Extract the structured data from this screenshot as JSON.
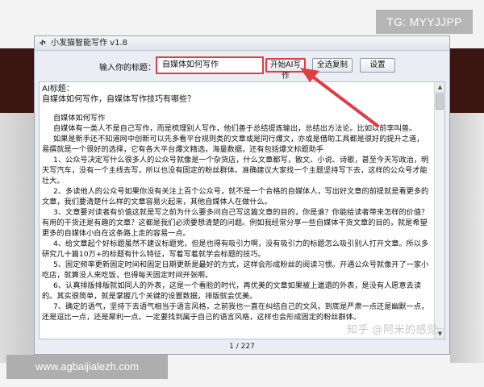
{
  "window": {
    "title": "小发猫智能写作 v1.8"
  },
  "toolbar": {
    "input_label": "输入你的标题：",
    "input_value": "自媒体如何写作",
    "start_button": "开始AI写作",
    "copy_all_button": "全选复制",
    "settings_button": "设置"
  },
  "editor": {
    "ai_label": "AI标题：",
    "ai_question": "自媒体如何写作，自媒体写作技巧有哪些？",
    "article_title": "自媒体如何写作",
    "paragraphs": [
      "自媒体有一类人不是自己写作，而是梳理别人写作，他们善于总结提炼输出，总结出方法论。比如以前李叫兽。",
      "如果是新手还不知道网中创新可以先多看平台规则类的文章或是同行爆文，亦或是借助工具都是很好的提升之道，易撰就是一个很好的选择，它有各大平台爆文精选，海量数据，还有包括爆文标题助手",
      "1、公众号决定写什么很多人的公众号就像是一个杂货店，什么文章都写，散文、小说、诗歌，甚至今天写政治，明天写汽车，没有一个主线去写，所以也没有固定的粉丝群体。准确建议大家找一个主题坚持写下去，这样的公众号才能壮大。",
      "2、多读他人的公众号如果你没有关注上百个公众号，就不是一个合格的自媒体人，写出好文章的前提就是看更多的文章，我们要清楚什么样的文章容易火起来，其他自媒体人在做什么。",
      "3、文章要对读者有价值这就是写之前为什么要多问自己写这篇文章的目的，你是谁？你能给读者带来怎样的价值？有用的干货还是有趣的文章？这都是我们必须要想清楚的问题。例如我经常分享一些自媒体干货文章的目的，就是希望更多的自媒体小白在这条路上走的容易一点。",
      "4、给文章起个好标题虽然不建议标题党，但是也得有吸引力啊，没有吸引力的标题怎么吸引别人打开文章。所以多研究几十篇10万+的标题有什么特征，写着写着就学会标题的技巧。",
      "5、固定频率更新固定时间和固定日期更新是最好的方式，这样会形成粉丝的阅读习惯。开通公众号就像开了一家小吃店，就算没人来吃饭，也得每天固定时间开张啊。",
      "6、认真排版排版就如同人的外表，这是一个看脸的时代，再优美的文章如果被上邋遢的外表，是没有人愿意去读的。其实很简单，就是掌握几个关键的设置数据，排版就会优美。",
      "7、确定的语气，坚持下去语气相当于语言风格，之前我也一直在纠结自己的文风，到底是严肃一点还是幽默一点，还是逗比一点，还是犀利一点。一定要找到属于自己的语言风格，这样也会形成固定的粉丝群体。"
    ]
  },
  "pager": {
    "label": "1 / 227"
  },
  "overlays": {
    "top_right_tag": "TG: MYYJJPP",
    "bottom_left_tag": "www.agbaijialezh.com",
    "watermark": "知乎 @阿米的感觉"
  },
  "icons": {
    "app": "app-logo-icon",
    "scroll_up": "scroll-up-arrow-icon",
    "scroll_down": "scroll-down-arrow-icon",
    "annotation": "red-arrow-annotation"
  },
  "colors": {
    "highlight": "#e03c45",
    "window_bg": "#eaeef4"
  }
}
